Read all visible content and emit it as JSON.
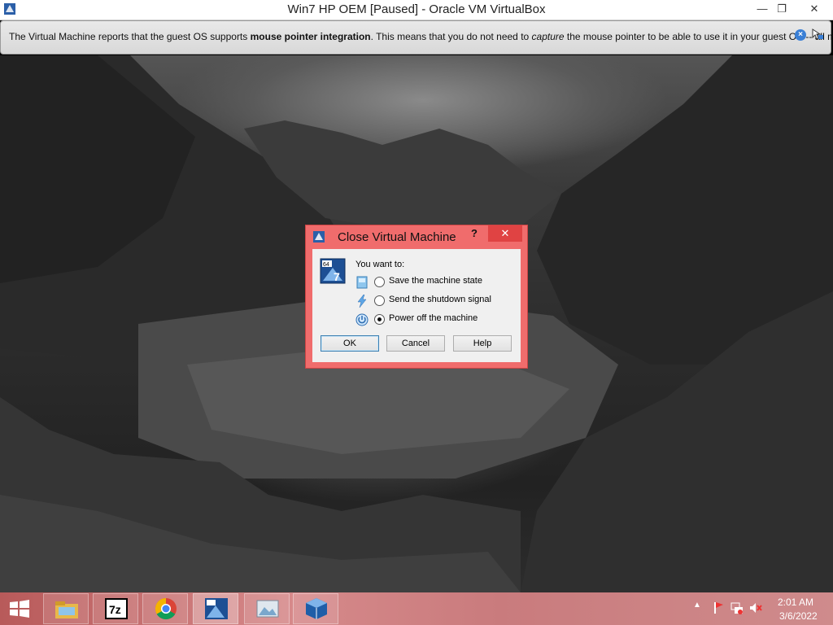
{
  "window": {
    "title": "Win7 HP OEM [Paused] - Oracle VM VirtualBox",
    "min_glyph": "—",
    "max_glyph": "❐",
    "close_glyph": "✕"
  },
  "notification": {
    "text_1": "The Virtual Machine reports that the guest OS supports ",
    "bold": "mouse pointer integration",
    "text_2": ". This means that you do not need to ",
    "italic": "capture",
    "text_3": " the mouse pointer to be able to use it in your guest OS -- all mouse",
    "close_glyph": "×",
    "icons": [
      "close-icon",
      "mouse-integration-icon"
    ]
  },
  "dialog": {
    "title": "Close Virtual Machine",
    "help_glyph": "?",
    "close_glyph": "✕",
    "prompt": "You want to:",
    "options": [
      {
        "label": "Save the machine state",
        "checked": false,
        "icon": "save-state-icon"
      },
      {
        "label": "Send the shutdown signal",
        "checked": false,
        "icon": "shutdown-signal-icon"
      },
      {
        "label": "Power off the machine",
        "checked": true,
        "icon": "power-off-icon"
      }
    ],
    "buttons": {
      "ok": "OK",
      "cancel": "Cancel",
      "help": "Help"
    }
  },
  "taskbar": {
    "items": [
      "start-icon",
      "file-explorer-icon",
      "7zip-icon",
      "chrome-icon",
      "win7-vm-icon",
      "image-viewer-icon",
      "virtualbox-icon"
    ],
    "seven_zip_label": "7z",
    "clock_time": "2:01 AM",
    "clock_date": "3/6/2022",
    "tray_icons": [
      "show-hidden-icons-icon",
      "action-center-icon",
      "network-icon",
      "volume-muted-icon"
    ],
    "tray_chevron": "▲"
  },
  "colors": {
    "dialog_frame": "#f06c6c",
    "dialog_close": "#e04343",
    "taskbar": "#c97b7d"
  }
}
